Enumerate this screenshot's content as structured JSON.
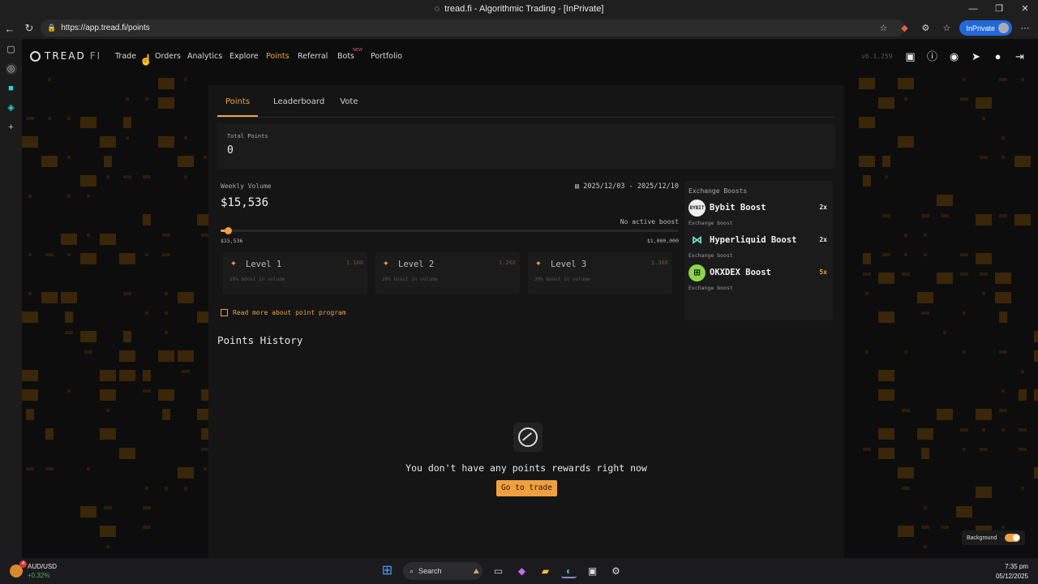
{
  "window": {
    "title": "tread.fi - Algorithmic Trading - [InPrivate]",
    "min": "—",
    "max": "❐",
    "close": "✕"
  },
  "browser": {
    "url": "https://app.tread.fi/points",
    "profile": "InPrivate",
    "back": "←",
    "refresh": "↻"
  },
  "app": {
    "logo_text": "TREAD",
    "logo_suffix": "FI",
    "nav": [
      {
        "label": "Trade"
      },
      {
        "label": "Orders"
      },
      {
        "label": "Analytics"
      },
      {
        "label": "Explore"
      },
      {
        "label": "Points"
      },
      {
        "label": "Referral"
      },
      {
        "label": "Bots",
        "badge": "NEW"
      },
      {
        "label": "Portfolio"
      }
    ],
    "version": "v6.1.259",
    "accent": "#f0a040"
  },
  "tabs": [
    {
      "label": "Points"
    },
    {
      "label": "Leaderboard"
    },
    {
      "label": "Vote"
    }
  ],
  "total_points": {
    "label": "Total Points",
    "value": "0"
  },
  "weekly": {
    "label": "Weekly Volume",
    "value": "$15,536",
    "date_range": "2025/12/03 - 2025/12/10",
    "no_boost": "No active boost",
    "min_label": "$15,536",
    "max_label": "$1,000,000",
    "progress_fraction": 0.0155
  },
  "levels": [
    {
      "name": "Level 1",
      "mult": "1.10X",
      "desc": "10% boost in volume"
    },
    {
      "name": "Level 2",
      "mult": "1.20X",
      "desc": "20% boost in volume"
    },
    {
      "name": "Level 3",
      "mult": "1.30X",
      "desc": "30% boost in volume"
    }
  ],
  "read_more": "Read more about point program",
  "exchange_boosts": {
    "title": "Exchange Boosts",
    "items": [
      {
        "logo": "BYBIT",
        "name": "Bybit Boost",
        "mult": "2x",
        "sub": "Exchange boost"
      },
      {
        "logo": "⋈",
        "name": "Hyperliquid Boost",
        "mult": "2x",
        "sub": "Exchange boost"
      },
      {
        "logo": "⊞",
        "name": "OKXDEX Boost",
        "mult": "5x",
        "sub": "Exchange boost"
      }
    ]
  },
  "history": {
    "title": "Points History",
    "empty": "You don't have any points rewards right now",
    "cta": "Go to trade"
  },
  "background_toggle": {
    "label": "Background",
    "on": true
  },
  "taskbar": {
    "ticker_pair": "AUD/USD",
    "ticker_change": "+0.32%",
    "search": "Search",
    "time": "7:35 pm",
    "date": "05/12/2025"
  }
}
